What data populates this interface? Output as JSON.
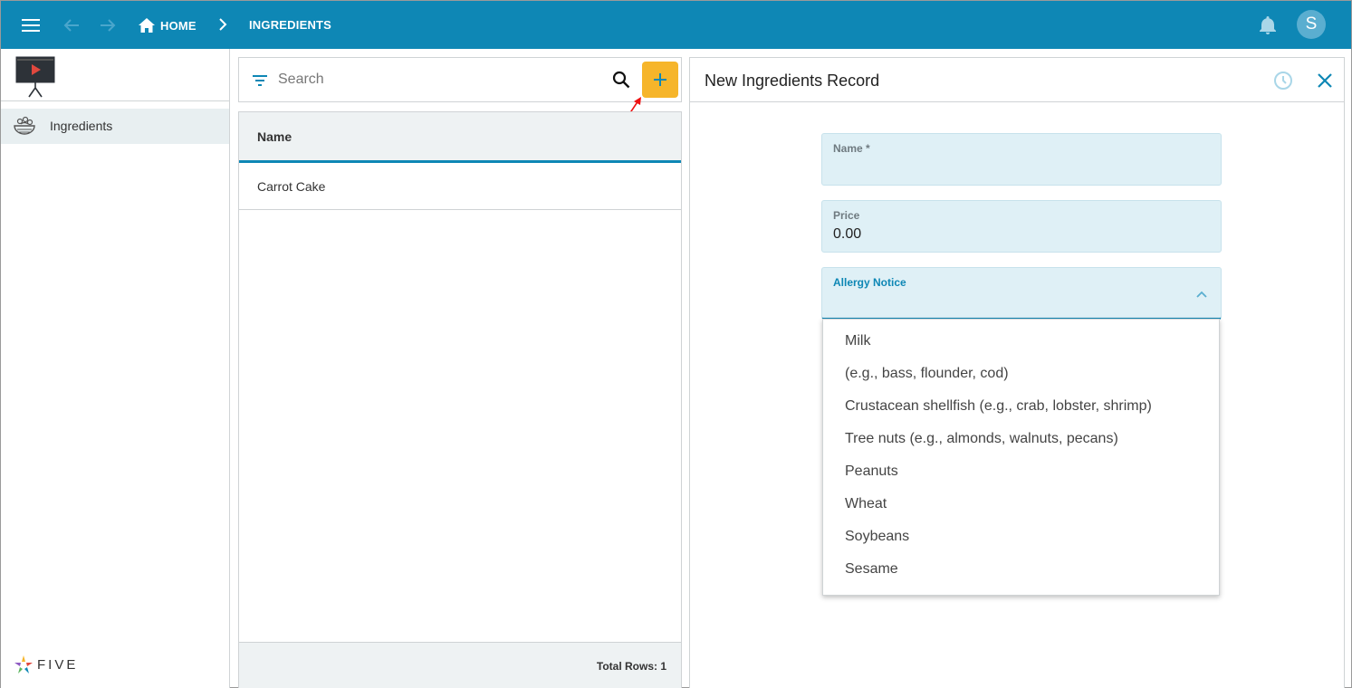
{
  "header": {
    "home_label": "HOME",
    "current_page": "INGREDIENTS",
    "avatar_initial": "S",
    "bar_color": "#0e87b5"
  },
  "sidebar": {
    "items": [
      {
        "label": "Ingredients",
        "icon": "salad-bowl-icon"
      }
    ],
    "brand": "FIVE"
  },
  "list": {
    "search_placeholder": "Search",
    "add_color": "#f6b52a",
    "column_header": "Name",
    "rows": [
      "Carrot Cake"
    ],
    "total_label": "Total Rows: 1"
  },
  "form": {
    "title": "New Ingredients Record",
    "fields": {
      "name_label": "Name *",
      "name_value": "",
      "price_label": "Price",
      "price_value": "0.00",
      "allergy_label": "Allergy Notice",
      "allergy_value": ""
    },
    "allergy_options": [
      "Milk",
      "(e.g., bass, flounder, cod)",
      "Crustacean shellfish (e.g., crab, lobster, shrimp)",
      "Tree nuts (e.g., almonds, walnuts, pecans)",
      "Peanuts",
      "Wheat",
      "Soybeans",
      "Sesame"
    ]
  }
}
